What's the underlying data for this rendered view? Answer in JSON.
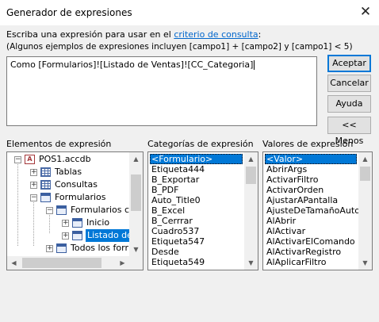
{
  "window": {
    "title": "Generador de expresiones",
    "close_glyph": "✕"
  },
  "instructions": {
    "line1_prefix": "Escriba una expresión para usar en el ",
    "line1_link": "criterio de consulta",
    "line1_suffix": ":",
    "line2": "(Algunos ejemplos de expresiones incluyen [campo1] + [campo2] y [campo1] < 5)"
  },
  "expression": {
    "value": "Como [Formularios]![Listado de Ventas]![CC_Categoria]"
  },
  "buttons": {
    "ok": "Aceptar",
    "cancel": "Cancelar",
    "help": "Ayuda",
    "less": "<< Menos"
  },
  "elements": {
    "header": "Elementos de expresión",
    "tree": [
      {
        "label": "POS1.accdb",
        "icon": "database-icon",
        "expander": "−"
      },
      {
        "label": "Tablas",
        "icon": "table-icon",
        "expander": "+"
      },
      {
        "label": "Consultas",
        "icon": "query-icon",
        "expander": "+"
      },
      {
        "label": "Formularios",
        "icon": "form-icon",
        "expander": "−"
      },
      {
        "label": "Formularios ca",
        "icon": "form-icon",
        "expander": "−"
      },
      {
        "label": "Inicio",
        "icon": "form-icon",
        "expander": "+"
      },
      {
        "label": "Listado de",
        "icon": "form-icon",
        "expander": "+",
        "selected": true
      },
      {
        "label": "Todos los forr",
        "icon": "form-icon",
        "expander": "+"
      }
    ]
  },
  "categories": {
    "header": "Categorías de expresión",
    "items": [
      "<Formulario>",
      "Etiqueta444",
      "B_Exportar",
      "B_PDF",
      "Auto_Title0",
      "B_Excel",
      "B_Cerrrar",
      "Cuadro537",
      "Etiqueta547",
      "Desde",
      "Etiqueta549"
    ]
  },
  "values": {
    "header": "Valores de expresión",
    "items": [
      "<Valor>",
      "AbrirArgs",
      "ActivarFiltro",
      "ActivarOrden",
      "AjustarAPantalla",
      "AjusteDeTamañoAutom",
      "AlAbrir",
      "AlActivar",
      "AlActivarElComando",
      "AlActivarRegistro",
      "AlAplicarFiltro"
    ]
  }
}
